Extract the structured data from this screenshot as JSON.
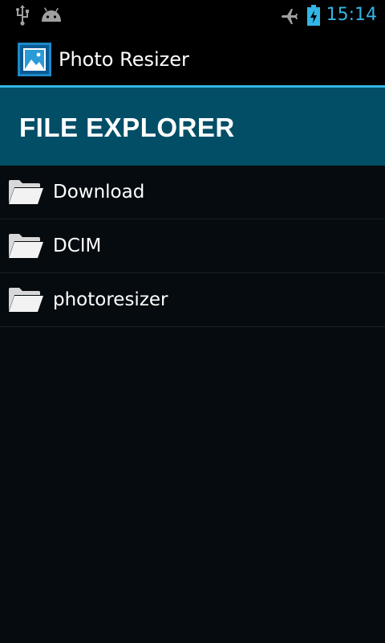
{
  "status_bar": {
    "time": "15:14",
    "icons": [
      "usb-icon",
      "android-icon",
      "airplane-mode-icon",
      "battery-charging-icon"
    ],
    "clock_color": "#33b5e5"
  },
  "action_bar": {
    "title": "Photo Resizer",
    "icon": "photo-resizer-app-icon"
  },
  "header": {
    "title": "FILE EXPLORER",
    "background": "#024e67"
  },
  "file_list": {
    "items": [
      {
        "name": "Download",
        "icon": "folder-icon"
      },
      {
        "name": "DCIM",
        "icon": "folder-icon"
      },
      {
        "name": "photoresizer",
        "icon": "folder-icon"
      }
    ]
  },
  "colors": {
    "accent": "#33b5e5",
    "background": "#050b0f"
  }
}
